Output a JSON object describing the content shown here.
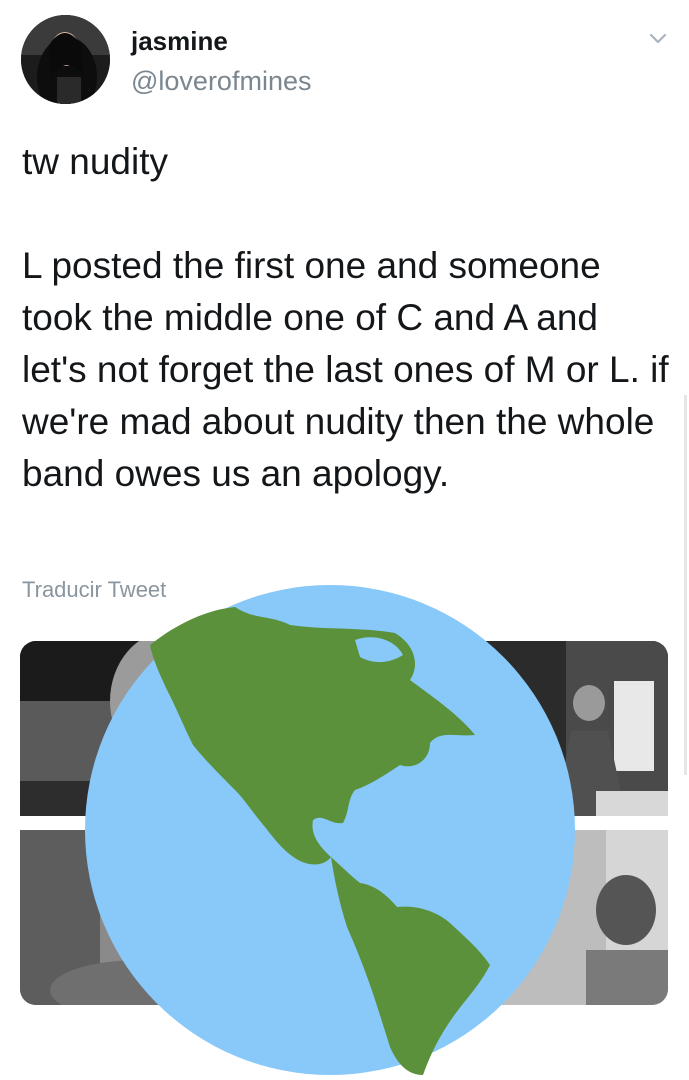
{
  "tweet": {
    "display_name": "jasmine",
    "handle": "@loverofmines",
    "text": "tw nudity\n\nL posted the first one and someone took the middle one of C and A and let's not forget the last ones of M or L. if we're mad about nudity then the whole band owes us an apology.",
    "translate_label": "Traducir Tweet"
  },
  "icons": {
    "menu": "chevron-down-icon",
    "overlay": "globe-americas-icon"
  },
  "colors": {
    "handle_gray": "#7a8690",
    "globe_ocean": "#88c9f9",
    "globe_land": "#5c913b"
  }
}
